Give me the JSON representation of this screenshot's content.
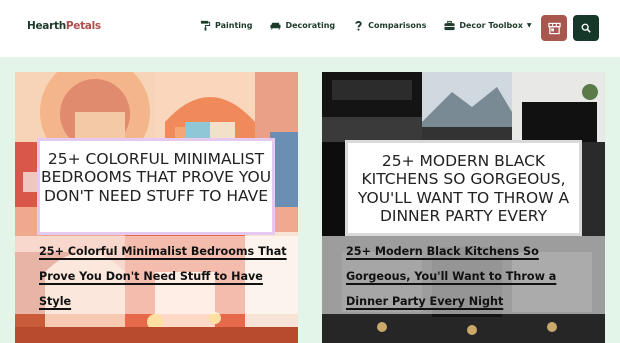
{
  "brand": {
    "name_part1": "Hearth",
    "name_part2": "Petals"
  },
  "nav": {
    "items": [
      {
        "label": "Painting",
        "icon": "paint-roller-icon"
      },
      {
        "label": "Decorating",
        "icon": "sofa-icon"
      },
      {
        "label": "Comparisons",
        "icon": "question-icon"
      },
      {
        "label": "Decor Toolbox",
        "icon": "toolbox-icon",
        "has_dropdown": true
      }
    ]
  },
  "actions": {
    "store_icon": "storefront-icon",
    "search_icon": "search-icon"
  },
  "cards": [
    {
      "overlay_text": "25+ COLORFUL MINIMALIST BEDROOMS THAT PROVE YOU DON'T NEED STUFF TO HAVE",
      "title": "25+ Colorful Minimalist Bedrooms That Prove You Don't Need Stuff to Have Style"
    },
    {
      "overlay_text": "25+ MODERN BLACK KITCHENS SO GORGEOUS, YOU'LL WANT TO THROW A DINNER PARTY EVERY",
      "title": "25+ Modern Black Kitchens So Gorgeous, You'll Want to Throw a Dinner Party Every Night"
    }
  ],
  "colors": {
    "accent": "#a8574e",
    "dark": "#15382a",
    "background": "#e3f4e8"
  }
}
